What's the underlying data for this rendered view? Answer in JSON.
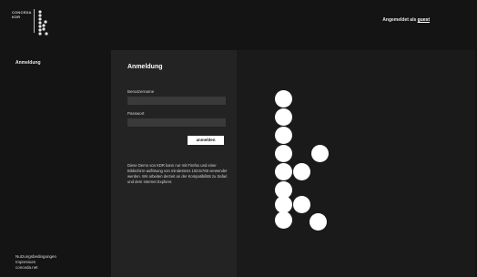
{
  "brand": {
    "line1": "CONCEDA",
    "line2": "KDR",
    "logo_icon": "k-dots-logo"
  },
  "header": {
    "logged_in_prefix": "Angemeldet als",
    "username": "guest"
  },
  "sidebar": {
    "items": [
      {
        "label": "Anmeldung"
      }
    ]
  },
  "login": {
    "title": "Anmeldung",
    "username_label": "Benutzername",
    "username_value": "",
    "password_label": "Passwort",
    "password_value": "",
    "submit_label": "anmelden",
    "notice": "Diese Demo von KDR kann nur mit Firefox und einer Bildschirm-auflösung von mindestens 1024x768 verwendet werden. Wir arbeiten derzeit an der Kompatibilität zu Safari und dem Internet Explorer."
  },
  "footer": {
    "links": [
      "Nutzungsbedingungen",
      "Impressum",
      "conceda.net"
    ]
  },
  "colors": {
    "background": "#141414",
    "panel": "#232323",
    "right_area": "#1a1a1a",
    "input": "#3a3a3a",
    "dots": "#ffffff"
  },
  "decoration": {
    "large_logo_icon": "k-dots-large-logo"
  }
}
